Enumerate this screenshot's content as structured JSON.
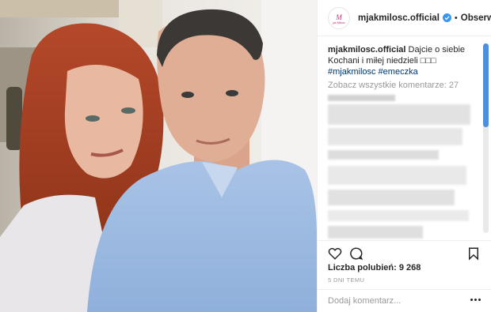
{
  "post": {
    "username": "mjakmilosc.official",
    "avatar_text": "M jak Miłość",
    "follow_label": "Obserwowa",
    "caption_user": "mjakmilosc.official",
    "caption_text": "Dajcie o siebie Kochani i miłej niedzieli □□□",
    "hashtags": "#mjakmilosc #emeczka",
    "view_all": "Zobacz wszystkie komentarze: 27",
    "likes_label": "Liczba polubień:",
    "likes_count": "9 268",
    "time_ago": "5 DNI TEMU",
    "comment_placeholder": "Dodaj komentarz..."
  },
  "icons": {
    "verified": "verified-badge-icon",
    "like": "heart-icon",
    "comment": "comment-bubble-icon",
    "save": "bookmark-icon",
    "more": "more-options-icon"
  },
  "colors": {
    "verified_blue": "#3897f0",
    "hashtag_blue": "#003569",
    "scrollbar_thumb": "#4e8fdd",
    "muted_text": "#999999"
  }
}
